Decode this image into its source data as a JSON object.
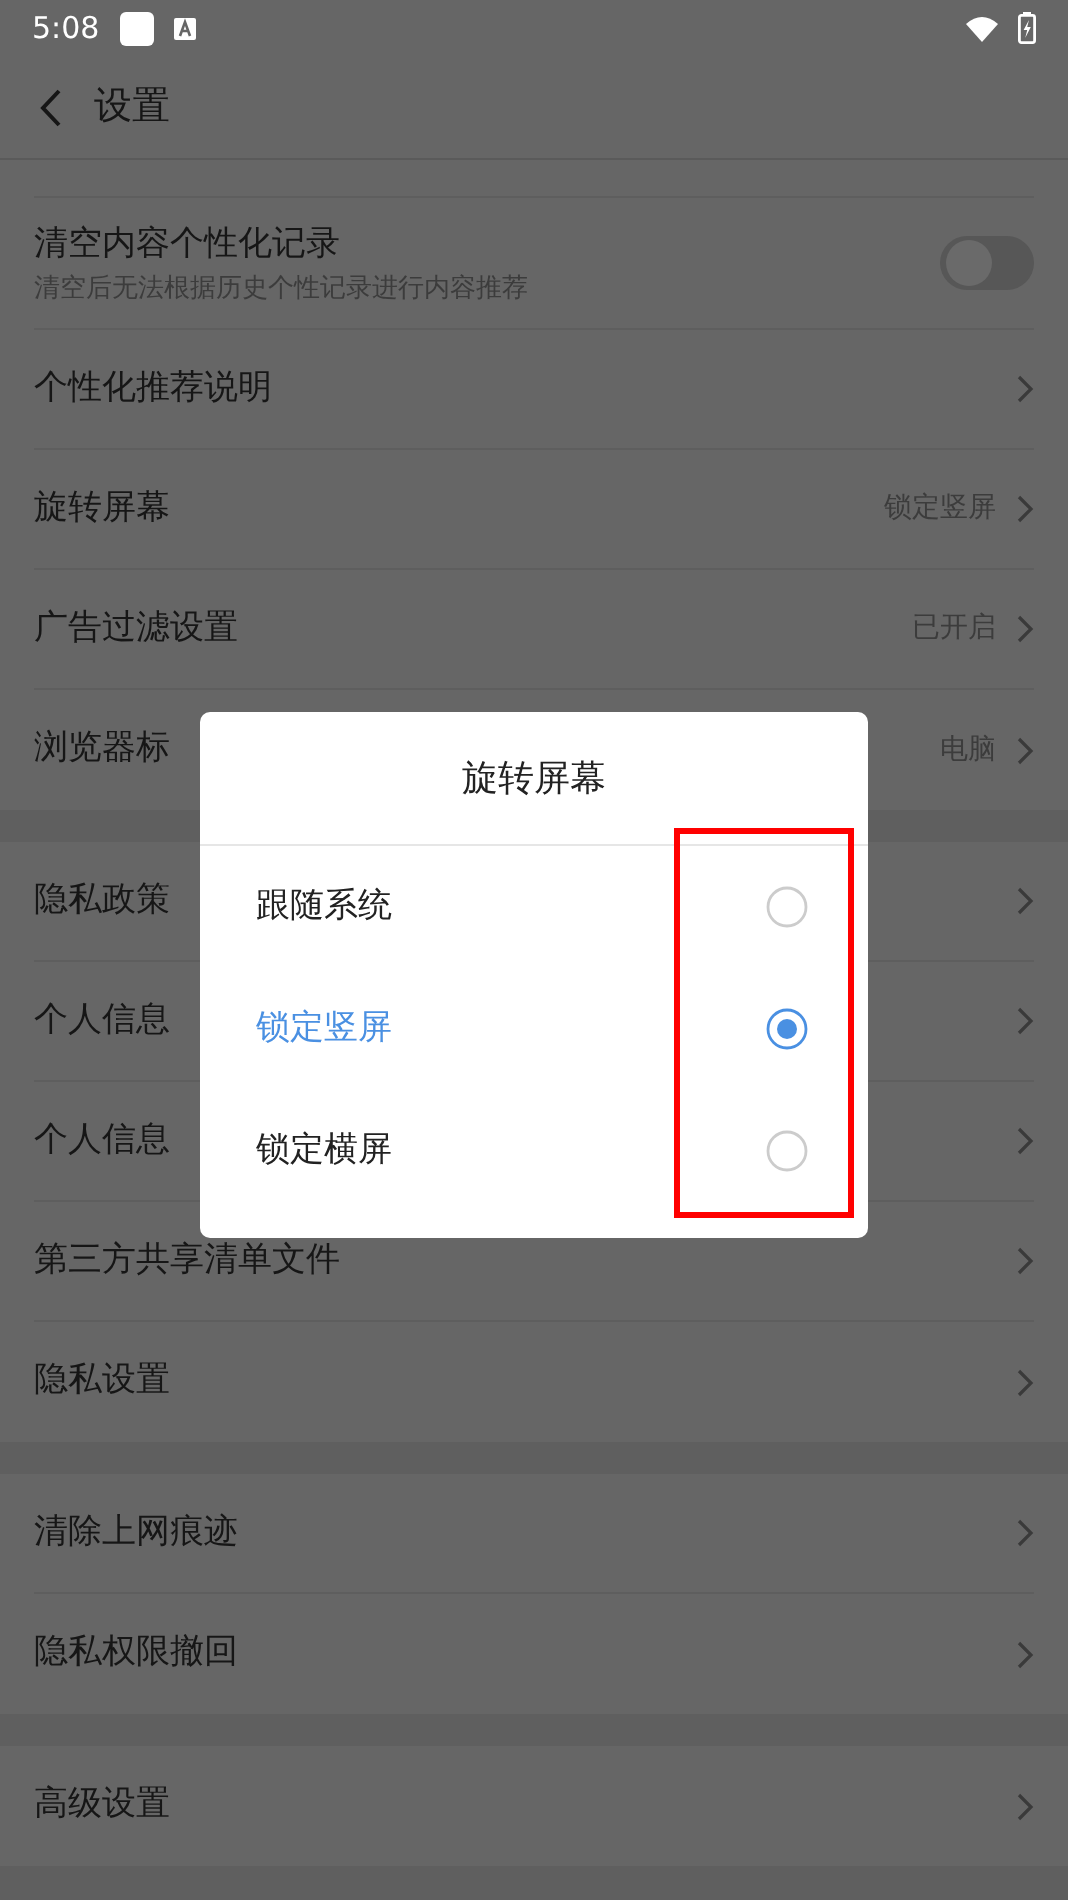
{
  "status_bar": {
    "time": "5:08"
  },
  "header": {
    "title": "设置"
  },
  "sections": [
    {
      "items": [
        {
          "kind": "toggle",
          "title": "清空内容个性化记录",
          "subtitle": "清空后无法根据历史个性记录进行内容推荐",
          "on": false
        },
        {
          "kind": "link",
          "title": "个性化推荐说明"
        },
        {
          "kind": "link",
          "title": "旋转屏幕",
          "value": "锁定竖屏"
        },
        {
          "kind": "link",
          "title": "广告过滤设置",
          "value": "已开启"
        },
        {
          "kind": "link",
          "title": "浏览器标",
          "value": "电脑"
        }
      ]
    },
    {
      "items": [
        {
          "kind": "link",
          "title": "隐私政策"
        },
        {
          "kind": "link",
          "title": "个人信息"
        },
        {
          "kind": "link",
          "title": "个人信息"
        },
        {
          "kind": "link",
          "title": "第三方共享清单文件"
        },
        {
          "kind": "link",
          "title": "隐私设置"
        }
      ]
    },
    {
      "items": [
        {
          "kind": "link",
          "title": "清除上网痕迹"
        },
        {
          "kind": "link",
          "title": "隐私权限撤回"
        }
      ]
    },
    {
      "items": [
        {
          "kind": "link",
          "title": "高级设置"
        }
      ]
    }
  ],
  "dialog": {
    "title": "旋转屏幕",
    "options": [
      {
        "label": "跟随系统",
        "selected": false
      },
      {
        "label": "锁定竖屏",
        "selected": true
      },
      {
        "label": "锁定横屏",
        "selected": false
      }
    ]
  }
}
